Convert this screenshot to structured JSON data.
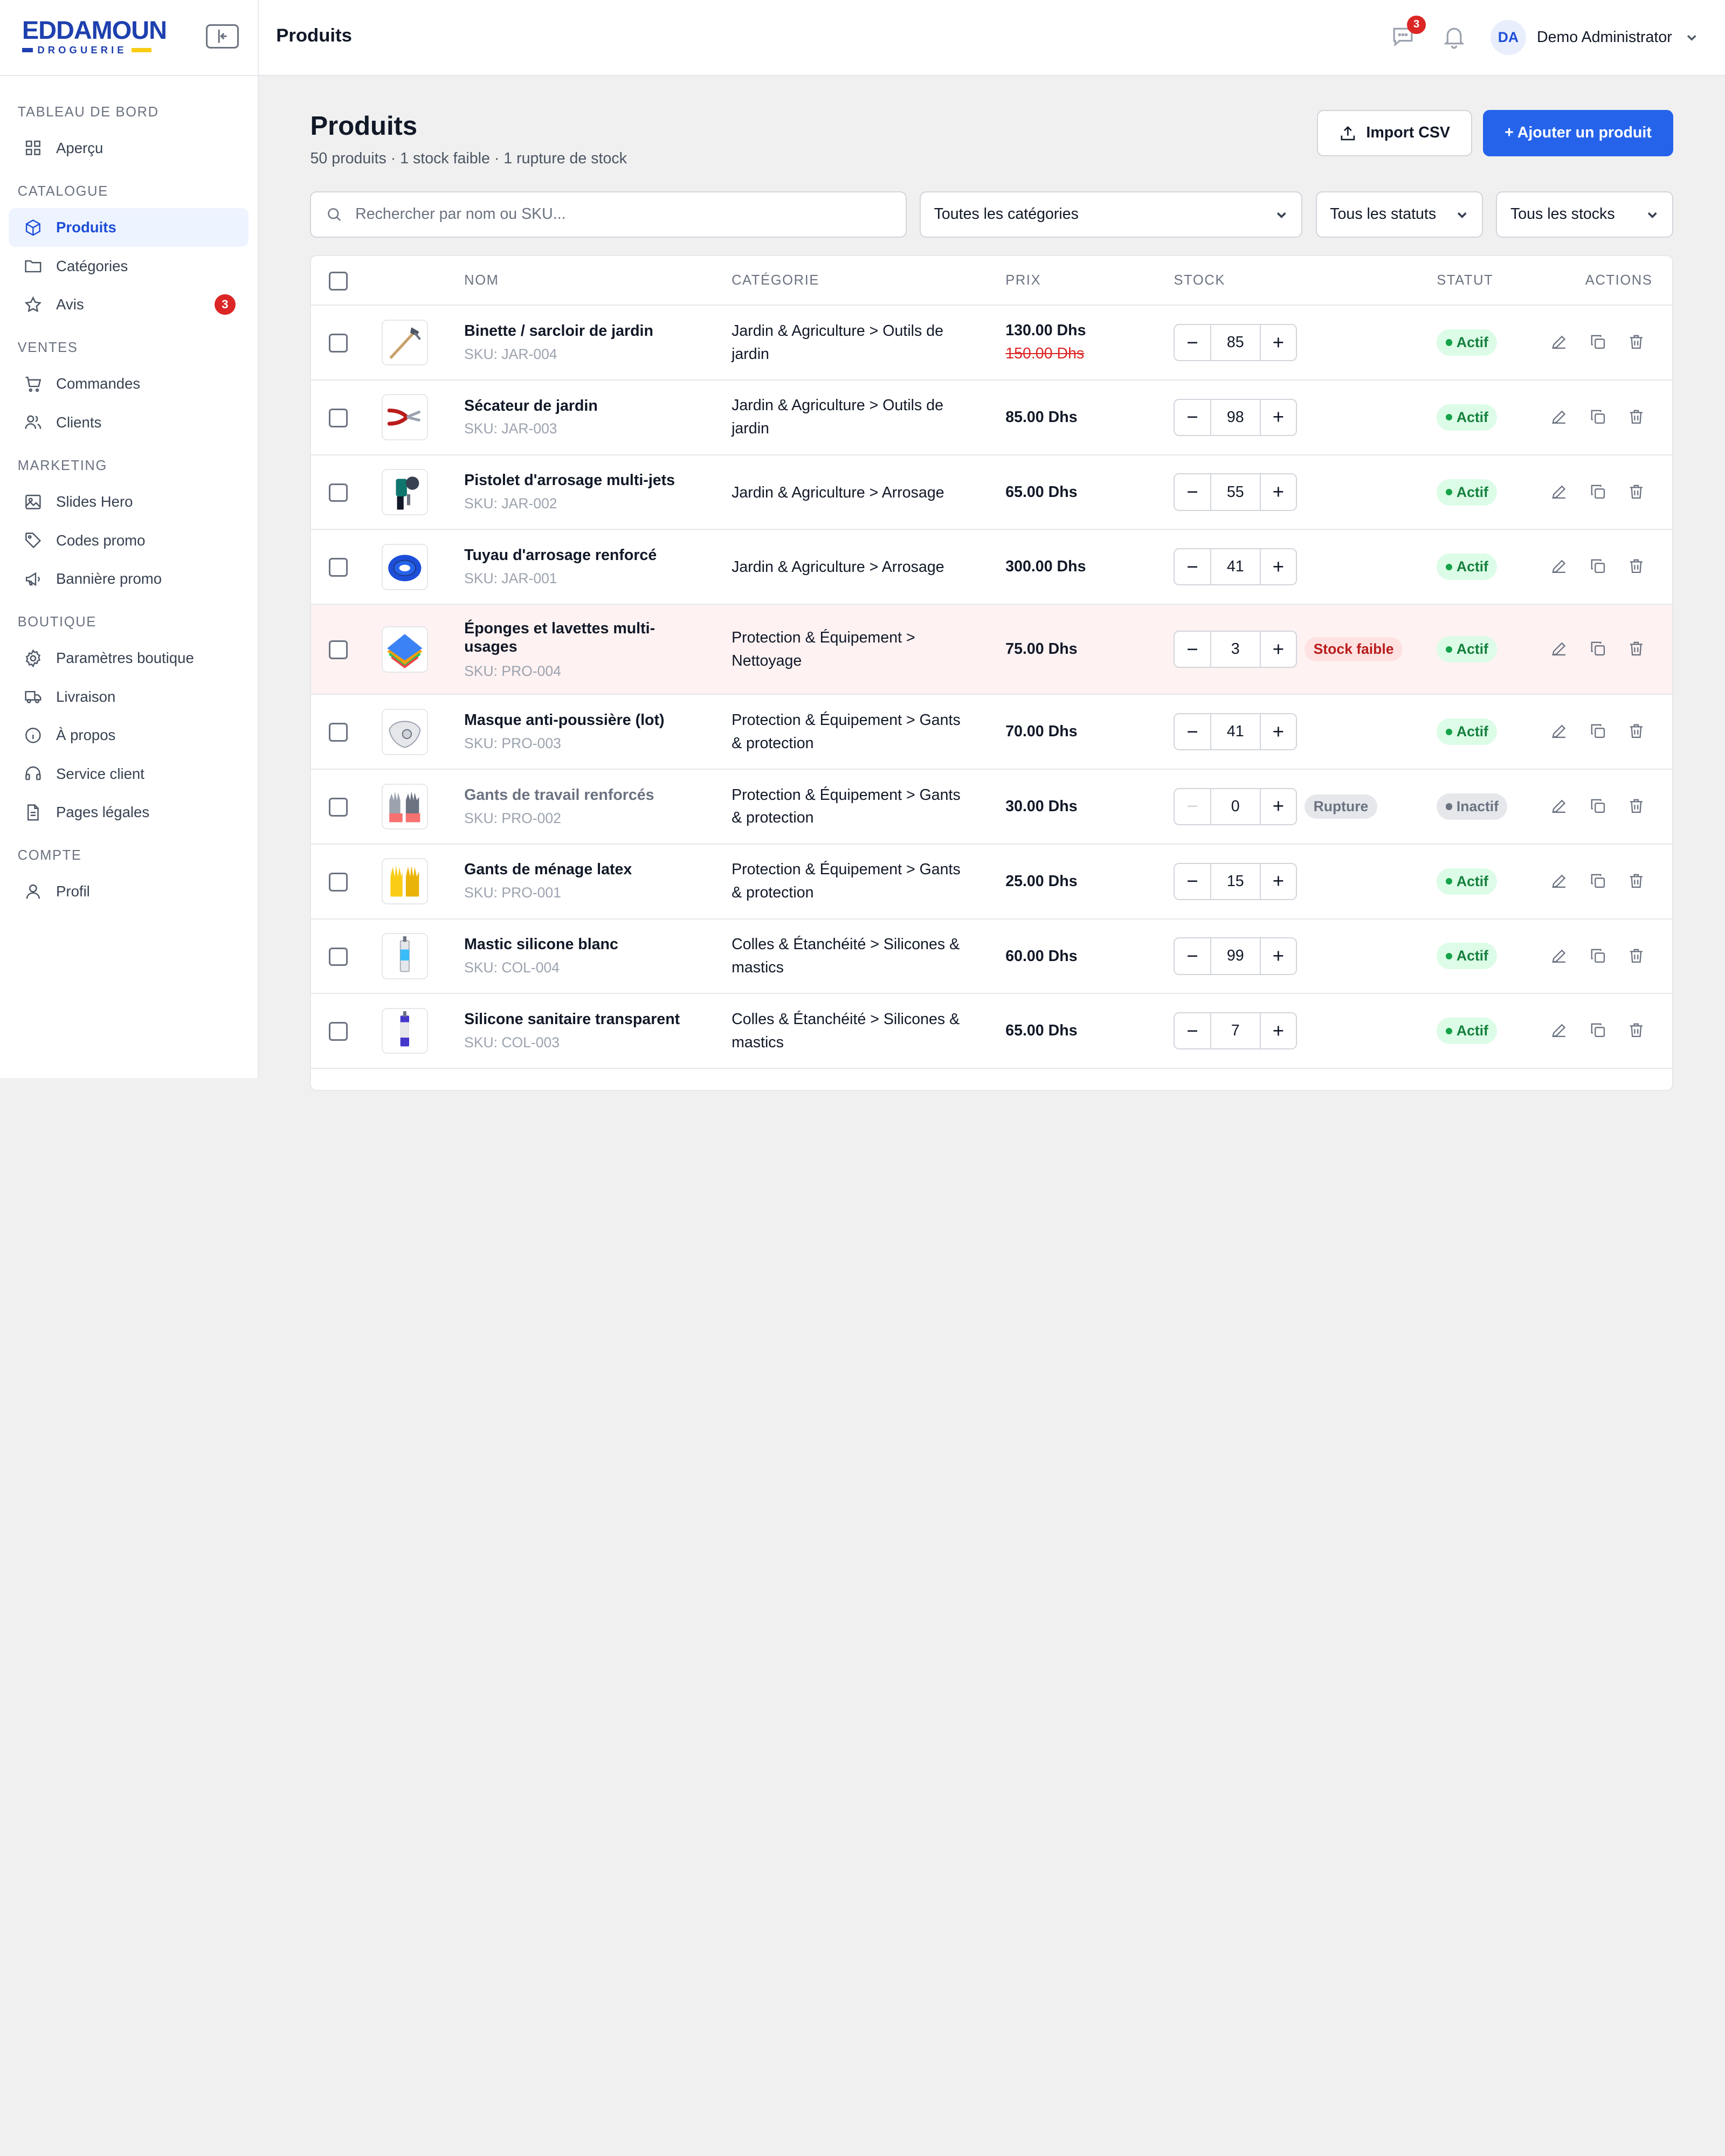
{
  "brand": {
    "name": "EDDAMOUN",
    "sub": "DROGUERIE"
  },
  "sidebar": {
    "sections": [
      {
        "title": "TABLEAU DE BORD",
        "items": [
          {
            "label": "Aperçu",
            "icon": "grid-icon"
          }
        ]
      },
      {
        "title": "CATALOGUE",
        "items": [
          {
            "label": "Produits",
            "icon": "box-icon",
            "active": true
          },
          {
            "label": "Catégories",
            "icon": "folder-icon"
          },
          {
            "label": "Avis",
            "icon": "star-icon",
            "badge": "3"
          }
        ]
      },
      {
        "title": "VENTES",
        "items": [
          {
            "label": "Commandes",
            "icon": "cart-icon"
          },
          {
            "label": "Clients",
            "icon": "users-icon"
          }
        ]
      },
      {
        "title": "MARKETING",
        "items": [
          {
            "label": "Slides Hero",
            "icon": "image-icon"
          },
          {
            "label": "Codes promo",
            "icon": "tag-icon"
          },
          {
            "label": "Bannière promo",
            "icon": "megaphone-icon"
          }
        ]
      },
      {
        "title": "BOUTIQUE",
        "items": [
          {
            "label": "Paramètres boutique",
            "icon": "gear-icon"
          },
          {
            "label": "Livraison",
            "icon": "truck-icon"
          },
          {
            "label": "À propos",
            "icon": "info-icon"
          },
          {
            "label": "Service client",
            "icon": "headset-icon"
          },
          {
            "label": "Pages légales",
            "icon": "document-icon"
          }
        ]
      },
      {
        "title": "COMPTE",
        "items": [
          {
            "label": "Profil",
            "icon": "user-icon"
          }
        ]
      }
    ]
  },
  "topbar": {
    "title": "Produits",
    "messages_badge": "3",
    "user_initials": "DA",
    "user_name": "Demo Administrator"
  },
  "page": {
    "title": "Produits",
    "subtitle": "50 produits · 1 stock faible · 1 rupture de stock",
    "import_label": "Import CSV",
    "add_label": "+ Ajouter un produit"
  },
  "filters": {
    "search_placeholder": "Rechercher par nom ou SKU...",
    "category": "Toutes les catégories",
    "status": "Tous les statuts",
    "stock": "Tous les stocks"
  },
  "table": {
    "headers": {
      "name": "NOM",
      "category": "CATÉGORIE",
      "price": "PRIX",
      "stock": "STOCK",
      "status": "STATUT",
      "actions": "ACTIONS"
    },
    "rows": [
      {
        "name": "Binette / sarcloir de jardin",
        "sku": "SKU: JAR-004",
        "category": "Jardin & Agriculture > Outils de jardin",
        "price": "130.00 Dhs",
        "old_price": "150.00 Dhs",
        "stock": "85",
        "status": "Actif",
        "thumb": "hoe"
      },
      {
        "name": "Sécateur de jardin",
        "sku": "SKU: JAR-003",
        "category": "Jardin & Agriculture > Outils de jardin",
        "price": "85.00 Dhs",
        "stock": "98",
        "status": "Actif",
        "thumb": "pruner"
      },
      {
        "name": "Pistolet d'arrosage multi-jets",
        "sku": "SKU: JAR-002",
        "category": "Jardin & Agriculture > Arrosage",
        "price": "65.00 Dhs",
        "stock": "55",
        "status": "Actif",
        "thumb": "nozzle"
      },
      {
        "name": "Tuyau d'arrosage renforcé",
        "sku": "SKU: JAR-001",
        "category": "Jardin & Agriculture > Arrosage",
        "price": "300.00 Dhs",
        "stock": "41",
        "status": "Actif",
        "thumb": "hose"
      },
      {
        "name": "Éponges et lavettes multi-usages",
        "sku": "SKU: PRO-004",
        "category": "Protection & Équipement > Nettoyage",
        "price": "75.00 Dhs",
        "stock": "3",
        "stock_flag": "Stock faible",
        "status": "Actif",
        "thumb": "sponge"
      },
      {
        "name": "Masque anti-poussière (lot)",
        "sku": "SKU: PRO-003",
        "category": "Protection & Équipement > Gants & protection",
        "price": "70.00 Dhs",
        "stock": "41",
        "status": "Actif",
        "thumb": "mask"
      },
      {
        "name": "Gants de travail renforcés",
        "sku": "SKU: PRO-002",
        "category": "Protection & Équipement > Gants & protection",
        "price": "30.00 Dhs",
        "stock": "0",
        "stock_flag": "Rupture",
        "status": "Inactif",
        "thumb": "workgloves"
      },
      {
        "name": "Gants de ménage latex",
        "sku": "SKU: PRO-001",
        "category": "Protection & Équipement > Gants & protection",
        "price": "25.00 Dhs",
        "stock": "15",
        "status": "Actif",
        "thumb": "latexgloves"
      },
      {
        "name": "Mastic silicone blanc",
        "sku": "SKU: COL-004",
        "category": "Colles & Étanchéité > Silicones & mastics",
        "price": "60.00 Dhs",
        "stock": "99",
        "status": "Actif",
        "thumb": "silicone-white"
      },
      {
        "name": "Silicone sanitaire transparent",
        "sku": "SKU: COL-003",
        "category": "Colles & Étanchéité > Silicones & mastics",
        "price": "65.00 Dhs",
        "stock": "7",
        "status": "Actif",
        "thumb": "silicone-clear"
      }
    ]
  },
  "colors": {
    "accent": "#2563eb",
    "danger": "#dc2626",
    "success": "#15803d",
    "low_row": "#fef2f2"
  }
}
